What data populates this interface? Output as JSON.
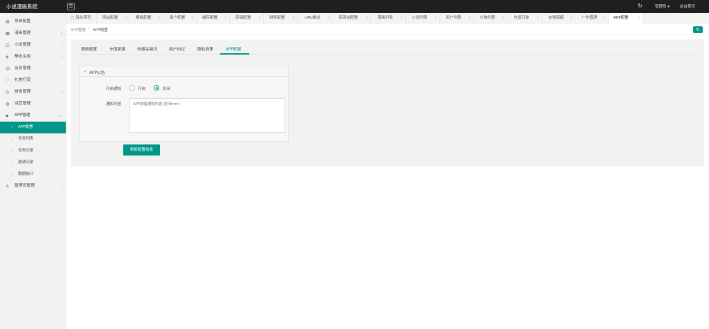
{
  "header": {
    "brand": "小说漫画系统",
    "admin_label": "管理员 ▾",
    "frontend_label": "前台首页"
  },
  "sidebar": {
    "items": [
      {
        "label": "系统配置",
        "icon": "doc-icon"
      },
      {
        "label": "漫画管理",
        "icon": "comic-icon"
      },
      {
        "label": "小说管理",
        "icon": "book-icon"
      },
      {
        "label": "静态生成",
        "icon": "layers-icon"
      },
      {
        "label": "会员管理",
        "icon": "user-icon"
      },
      {
        "label": "礼物打赏",
        "icon": "gift-icon"
      },
      {
        "label": "财务管理",
        "icon": "money-icon"
      },
      {
        "label": "运营管理",
        "icon": "globe-icon"
      },
      {
        "label": "APP管理",
        "icon": "grid-icon"
      }
    ],
    "sub_items": [
      {
        "label": "APP配置"
      },
      {
        "label": "任务列表"
      },
      {
        "label": "任务记录"
      },
      {
        "label": "邀请记录"
      },
      {
        "label": "数据统计"
      }
    ],
    "footer_item": {
      "label": "管理员管理",
      "icon": "person-icon"
    }
  },
  "tabs": [
    {
      "label": "后台首页"
    },
    {
      "label": "网站配置"
    },
    {
      "label": "模板配置"
    },
    {
      "label": "用户配置"
    },
    {
      "label": "缓存配置"
    },
    {
      "label": "存储配置"
    },
    {
      "label": "财务配置"
    },
    {
      "label": "URL推送"
    },
    {
      "label": "资源站配置"
    },
    {
      "label": "漫画列表"
    },
    {
      "label": "小说列表"
    },
    {
      "label": "用户列表"
    },
    {
      "label": "礼物列表"
    },
    {
      "label": "充值订单"
    },
    {
      "label": "友情链接"
    },
    {
      "label": "广告管理"
    },
    {
      "label": "APP配置"
    }
  ],
  "breadcrumb": {
    "parent": "APP管理",
    "separator": "/",
    "current": "APP配置"
  },
  "subtabs": [
    {
      "label": "更新配置"
    },
    {
      "label": "充值配置"
    },
    {
      "label": "热搜关键词"
    },
    {
      "label": "用户协议"
    },
    {
      "label": "隐私政策"
    },
    {
      "label": "APP配置"
    }
  ],
  "card": {
    "title": "APP公告",
    "switch_label": "开启通知",
    "option_on": "开启",
    "option_off": "关闭",
    "selected": "关闭",
    "content_label": "通知内容",
    "content_placeholder": "APP弹窗通知内容,支持html",
    "content_value": ""
  },
  "save_button": "更新配置信息",
  "colors": {
    "accent": "#009688",
    "header_bg": "#1f1f1f",
    "sidebar_bg": "#f2f2f2"
  }
}
